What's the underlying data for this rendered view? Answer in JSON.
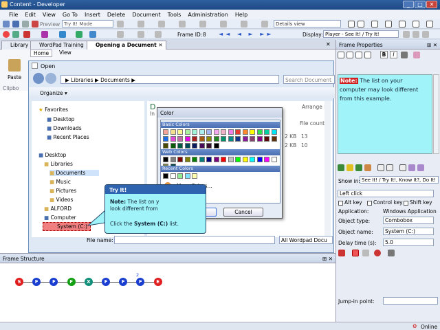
{
  "title": "Content - Developer",
  "menu": [
    "File",
    "Edit",
    "View",
    "Go To",
    "Insert",
    "Delete",
    "Document",
    "Tools",
    "Administration",
    "Help"
  ],
  "toolbar": {
    "preview": "Preview",
    "mode": "Try It! Mode",
    "frame_id_label": "Frame ID:",
    "frame_id": "8",
    "view": "Details view",
    "display_label": "Display:",
    "display_value": "Player - See It! / Try It!"
  },
  "tabs": [
    "Library",
    "WordPad Training",
    "Opening a Document"
  ],
  "ribbon": {
    "tab_home": "Home",
    "tab_view": "View",
    "paste": "Paste",
    "clipboard": "Clipbo"
  },
  "open_dialog": {
    "title": "Open",
    "path": [
      "Libraries",
      "Documents"
    ],
    "search": "Search Document",
    "organize": "Organize",
    "arrange": "Arrange b",
    "file_count": "File count",
    "doc_prefix": "D",
    "in_prefix": "In",
    "sizes": [
      "2 KB",
      "2 KB"
    ],
    "counts": [
      "13",
      "10"
    ],
    "tree": [
      "Favorites",
      "Desktop",
      "Downloads",
      "Recent Places",
      "Desktop",
      "Libraries",
      "Documents",
      "Music",
      "Pictures",
      "Videos",
      "ALFORD",
      "Computer",
      "System (C:)"
    ],
    "filename_label": "File name:",
    "filetype": "All Wordpad Docu"
  },
  "color_dialog": {
    "title": "Color",
    "basic": "Basic Colors",
    "web": "Web Colors",
    "recent": "Recent Colors",
    "more": "More Colors...",
    "ok": "Ok",
    "cancel": "Cancel",
    "basic_colors": [
      "#f6a39a",
      "#f5e08f",
      "#f8f88f",
      "#a9f0a0",
      "#9ff5d6",
      "#a8f0f0",
      "#a3b7f6",
      "#f5a8f2",
      "#f0b0c8",
      "#f07ee9",
      "#e83b2e",
      "#ff8a2e",
      "#ffff00",
      "#2fe04a",
      "#00d0a0",
      "#00e5f5",
      "#1c6ee8",
      "#e04ad6",
      "#c06aa8",
      "#e800e8",
      "#a8201c",
      "#a85a10",
      "#8a8a00",
      "#208a20",
      "#00906a",
      "#008a8a",
      "#10358a",
      "#8a1a9a",
      "#8a4070",
      "#8a008a",
      "#5a0a0a",
      "#603008",
      "#4a4a00",
      "#0a5a0a",
      "#005a40",
      "#004a5a",
      "#0a1a5a",
      "#4a0a5a",
      "#3a1030",
      "#000000"
    ],
    "web_colors": [
      "#000000",
      "#808080",
      "#800000",
      "#808000",
      "#008000",
      "#008080",
      "#000080",
      "#800080",
      "#ff0000",
      "#c0c0c0",
      "#00ff00",
      "#ffff00",
      "#00ffff",
      "#0000ff",
      "#ff00ff",
      "#ffffff",
      "#808040",
      "#004040"
    ],
    "recent_colors": [
      "#000000",
      "#ffffff",
      "#90ee90",
      "#80e0ff",
      "#ffffb0"
    ]
  },
  "callout": {
    "title": "Try It!",
    "note_label": "Note:",
    "note_text": "The list on y",
    "note_text2": "look different from",
    "click_text": "Click the",
    "click_bold": "System (C:)",
    "click_end": "list."
  },
  "properties": {
    "header": "Frame Properties",
    "note_label": "Note:",
    "note_text": "The list on your computer may look different from this example.",
    "show_in_label": "Show in:",
    "show_in": "See It! / Try It!, Know It?, Do It!",
    "action": "Left click",
    "alt": "Alt key",
    "ctrl": "Control key",
    "shift": "Shift key",
    "application_label": "Application:",
    "application": "Windows Application",
    "object_type_label": "Object type:",
    "object_type": "Combobox",
    "object_name_label": "Object name:",
    "object_name": "System (C:)",
    "delay_label": "Delay time (s):",
    "delay": "5.0",
    "jump_label": "Jump-in point:"
  },
  "frame_structure": {
    "header": "Frame Structure",
    "branch_label": "2",
    "nodes": [
      {
        "l": "S",
        "c": "#e02020"
      },
      {
        "l": "F",
        "c": "#1a3fd0"
      },
      {
        "l": "F",
        "c": "#1a3fd0"
      },
      {
        "l": "F",
        "c": "#14a014"
      },
      {
        "l": "X",
        "c": "#10907a"
      },
      {
        "l": "F",
        "c": "#1a3fd0"
      },
      {
        "l": "F",
        "c": "#1a3fd0"
      },
      {
        "l": "F",
        "c": "#1a3fd0"
      },
      {
        "l": "E",
        "c": "#e02020"
      }
    ]
  },
  "status": "Online"
}
